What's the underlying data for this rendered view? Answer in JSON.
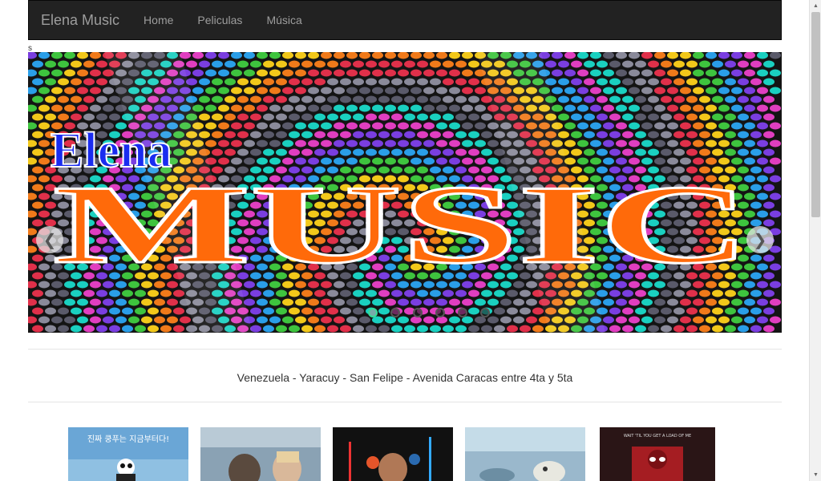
{
  "navbar": {
    "brand": "Elena Music",
    "links": [
      "Home",
      "Peliculas",
      "Música"
    ]
  },
  "stray_text": "s",
  "banner": {
    "title_word": "Elena",
    "main_word": "MUSIC",
    "slides": 6,
    "active_slide": 0,
    "colors": {
      "title": "#1a2cf0",
      "main": "#ff6a0a"
    }
  },
  "address": "Venezuela - Yaracuy - San Felipe - Avenida Caracas entre 4ta y 5ta",
  "posters": [
    {
      "name": "kung-fu-panda-poster",
      "caption": "진짜 쿵푸는 지금부터다!"
    },
    {
      "name": "fifth-wave-poster"
    },
    {
      "name": "star-wars-poster"
    },
    {
      "name": "ice-age-poster"
    },
    {
      "name": "deadpool-poster",
      "caption": "WAIT 'TIL YOU GET A LOAD OF ME"
    }
  ]
}
